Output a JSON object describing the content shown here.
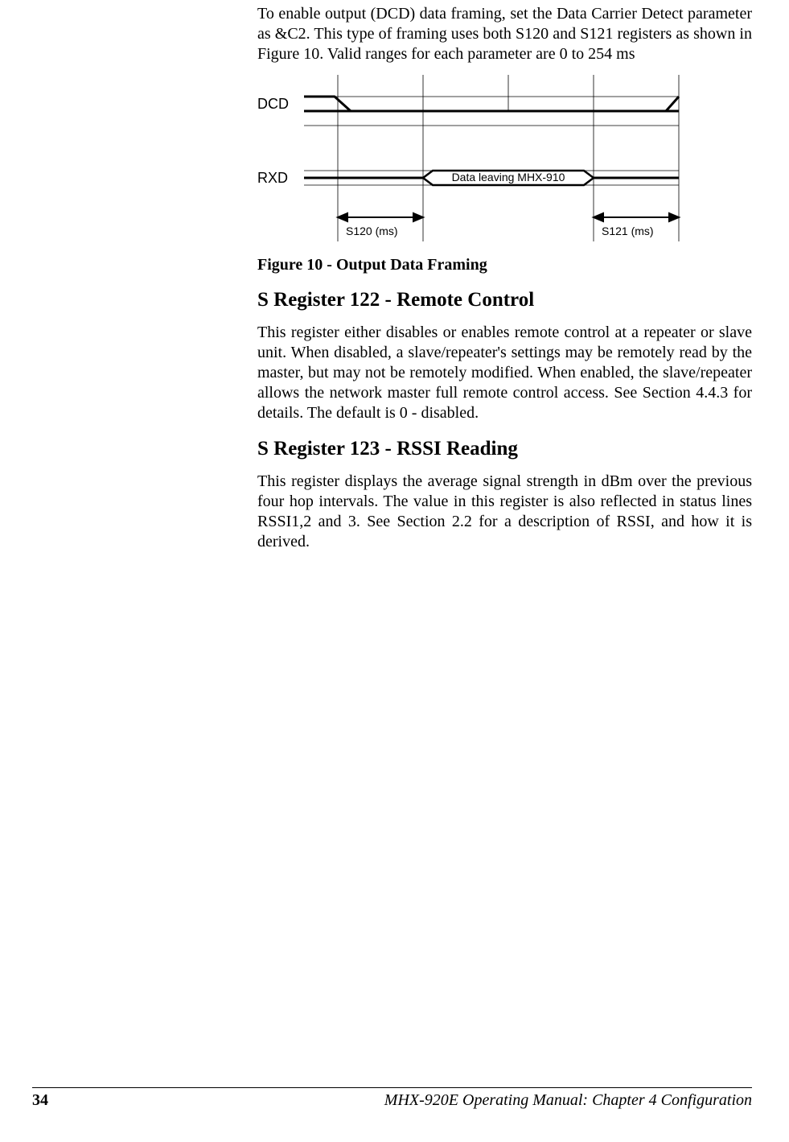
{
  "intro_paragraph": "To enable output (DCD) data framing, set the Data Carrier Detect parameter as &C2.  This type of framing uses both S120 and S121 registers as shown in Figure 10.  Valid ranges for each parameter are 0 to 254 ms",
  "figure_caption": "Figure 10 - Output Data Framing",
  "diagram": {
    "dcd_label": "DCD",
    "rxd_label": "RXD",
    "data_box_label": "Data leaving MHX-910",
    "s120_label": "S120 (ms)",
    "s121_label": "S121 (ms)"
  },
  "section_122_heading": "S Register 122  -  Remote Control",
  "section_122_body": "This register either disables or enables remote control at a repeater or slave unit.  When disabled, a slave/repeater's settings may be remotely read by the master, but may not be remotely modified.  When enabled, the slave/repeater allows the network master full remote control access.  See Section 4.4.3 for details.  The default is 0 - disabled.",
  "section_123_heading": "S Register 123  -  RSSI Reading",
  "section_123_body": "This register displays the average signal strength in dBm over the previous four hop intervals.  The value in this register is also reflected in status lines RSSI1,2 and 3.  See Section 2.2 for a description of RSSI, and how it is derived.",
  "footer": {
    "page_number": "34",
    "right_text": "MHX-920E Operating Manual: Chapter 4 Configuration"
  }
}
